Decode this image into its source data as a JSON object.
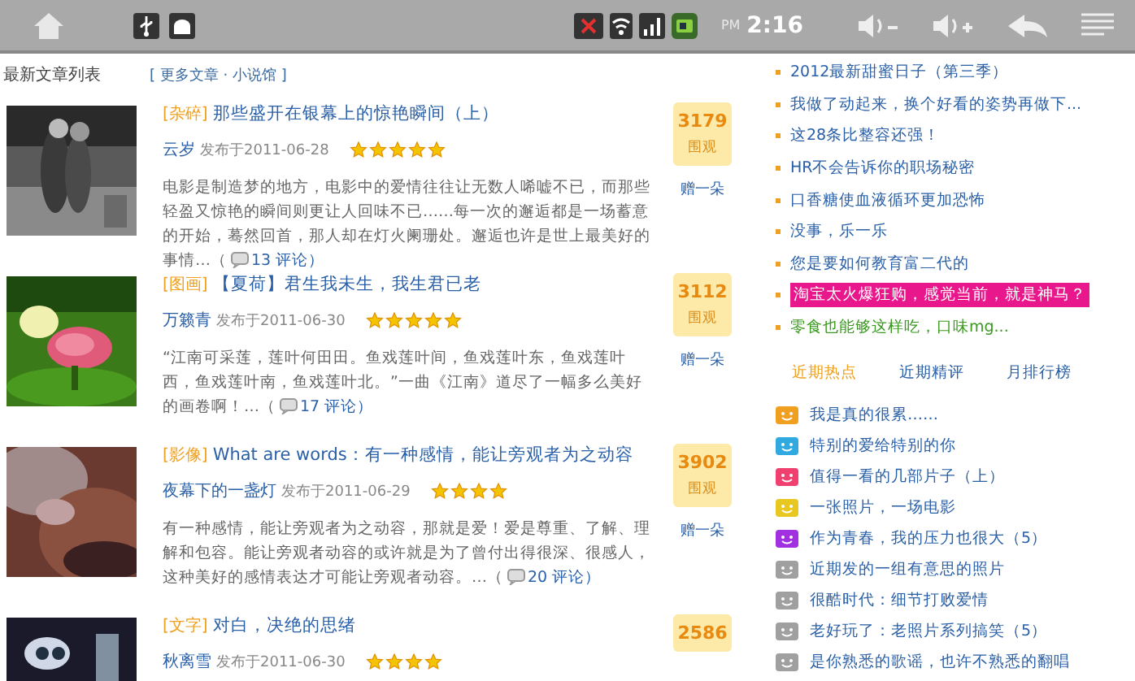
{
  "status_bar": {
    "clock_suffix": "PM",
    "clock": "2:16"
  },
  "articles_header": {
    "title": "最新文章列表",
    "more": "[ 更多文章 · 小说馆 ]"
  },
  "articles": [
    {
      "tag": "[杂碎]",
      "title": "那些盛开在银幕上的惊艳瞬间（上）",
      "author": "云岁",
      "date": "发布于2011-06-28",
      "stars": 5,
      "excerpt": "电影是制造梦的地方，电影中的爱情往往让无数人唏嘘不已，而那些轻盈又惊艳的瞬间则更让人回味不已……每一次的邂逅都是一场蓄意的开始，蓦然回首，那人却在灯火阑珊处。邂逅也许是世上最美好的事情…（",
      "comments": "13 评论）",
      "count": "3179",
      "count_label": "围观",
      "action": "赠一朵"
    },
    {
      "tag": "[图画]",
      "title": "【夏荷】君生我未生，我生君已老",
      "author": "万籁青",
      "date": "发布于2011-06-30",
      "stars": 5,
      "excerpt": "“江南可采莲，莲叶何田田。鱼戏莲叶间，鱼戏莲叶东，鱼戏莲叶西，鱼戏莲叶南，鱼戏莲叶北。”一曲《江南》道尽了一幅多么美好的画卷啊！…（",
      "comments": "17 评论）",
      "count": "3112",
      "count_label": "围观",
      "action": "赠一朵"
    },
    {
      "tag": "[影像]",
      "title": "What are words：有一种感情，能让旁观者为之动容",
      "author": "夜幕下的一盏灯",
      "date": "发布于2011-06-29",
      "stars": 4,
      "excerpt": "有一种感情，能让旁观者为之动容，那就是爱！爱是尊重、了解、理解和包容。能让旁观者动容的或许就是为了曾付出得很深、很感人，这种美好的感情表达才可能让旁观者动容。…（",
      "comments": "20 评论）",
      "count": "3902",
      "count_label": "围观",
      "action": "赠一朵"
    },
    {
      "tag": "[文字]",
      "title": "对白，决绝的思绪",
      "author": "秋离雪",
      "date": "发布于2011-06-30",
      "stars": 4,
      "count": "2586"
    }
  ],
  "sidebar_list": [
    {
      "kind": "normal",
      "text": "2012最新甜蜜日子（第三季）"
    },
    {
      "kind": "normal",
      "text": "我做了动起来，换个好看的姿势再做下..."
    },
    {
      "kind": "normal",
      "text": "这28条比整容还强！"
    },
    {
      "kind": "normal",
      "text": "HR不会告诉你的职场秘密"
    },
    {
      "kind": "normal",
      "text": "口香糖使血液循环更加恐怖"
    },
    {
      "kind": "normal",
      "text": "没事，乐一乐"
    },
    {
      "kind": "normal",
      "text": "您是要如何教育富二代的"
    },
    {
      "kind": "highlight",
      "text": "淘宝太火爆狂购，感觉当前，就是神马？"
    },
    {
      "kind": "featured",
      "text": "零食也能够这样吃，口味mg..."
    }
  ],
  "sidebar_tabs": [
    {
      "label": "近期热点",
      "selected": true
    },
    {
      "label": "近期精评",
      "selected": false
    },
    {
      "label": "月排行榜",
      "selected": false
    }
  ],
  "hot_list": [
    {
      "color": "#f0a020",
      "text": "我是真的很累……"
    },
    {
      "color": "#30a8e0",
      "text": "特别的爱给特别的你"
    },
    {
      "color": "#f04070",
      "text": "值得一看的几部片子（上）"
    },
    {
      "color": "#e8c820",
      "text": "一张照片，一场电影"
    },
    {
      "color": "#a030e0",
      "text": "作为青春，我的压力也很大（5）"
    },
    {
      "color": "#a0a0a0",
      "text": "近期发的一组有意思的照片"
    },
    {
      "color": "#a0a0a0",
      "text": "很酷时代：细节打败爱情"
    },
    {
      "color": "#a0a0a0",
      "text": "老好玩了：老照片系列搞笑（5）"
    },
    {
      "color": "#a0a0a0",
      "text": "是你熟悉的歌谣，也许不熟悉的翻唱"
    }
  ]
}
